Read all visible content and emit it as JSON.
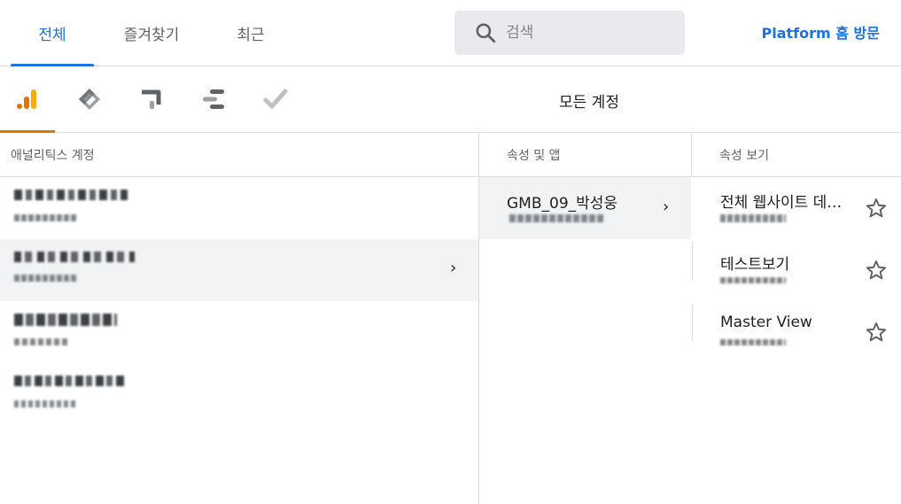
{
  "header": {
    "tabs": [
      {
        "label": "전체",
        "active": true
      },
      {
        "label": "즐겨찾기",
        "active": false
      },
      {
        "label": "최근",
        "active": false
      }
    ],
    "search_placeholder": "검색",
    "visit_platform": "Platform 홈 방문"
  },
  "products": {
    "icons": [
      "analytics-icon",
      "tag-manager-icon",
      "optimize-icon",
      "data-studio-icon",
      "surveys-icon"
    ],
    "active_index": 0,
    "all_accounts": "모든 계정"
  },
  "columns": {
    "accounts_header": "애널리틱스 계정",
    "properties_header": "속성 및 앱",
    "views_header": "속성 보기"
  },
  "accounts": [
    {
      "name": "(blurred)",
      "id": "(blurred)"
    },
    {
      "name": "(blurred)",
      "id": "(blurred)",
      "selected": true
    },
    {
      "name": "(blurred)",
      "id": "(blurred)"
    },
    {
      "name": "(blurred)",
      "id": "(blurred)"
    }
  ],
  "properties": [
    {
      "name": "GMB_09_박성웅",
      "id": "(blurred)"
    }
  ],
  "views": [
    {
      "name": "전체 웹사이트 데이터",
      "id": "(blurred)"
    },
    {
      "name": "테스트보기",
      "id": "(blurred)"
    },
    {
      "name": "Master View",
      "id": "(blurred)"
    }
  ],
  "colors": {
    "accent": "#1a73e8",
    "analytics_orange": "#e37400",
    "selected_bg": "#f1f3f4"
  }
}
